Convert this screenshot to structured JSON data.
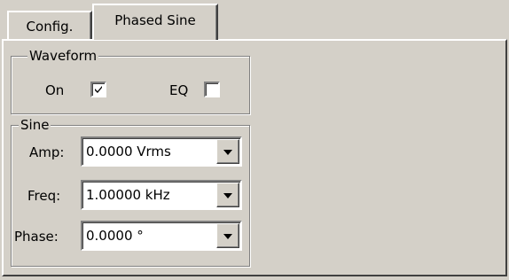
{
  "tabs": [
    {
      "label": "Config."
    },
    {
      "label": "Phased Sine"
    }
  ],
  "waveform": {
    "title": "Waveform",
    "on_label": "On",
    "on_checked": true,
    "eq_label": "EQ",
    "eq_checked": false
  },
  "sine": {
    "title": "Sine",
    "amp_label": "Amp:",
    "amp_value": "0.0000 Vrms",
    "freq_label": "Freq:",
    "freq_value": "1.00000 kHz",
    "phase_label": "Phase:",
    "phase_value": "0.0000 °"
  },
  "icons": {
    "checkmark": "check-icon",
    "dropdown": "chevron-down-icon"
  }
}
